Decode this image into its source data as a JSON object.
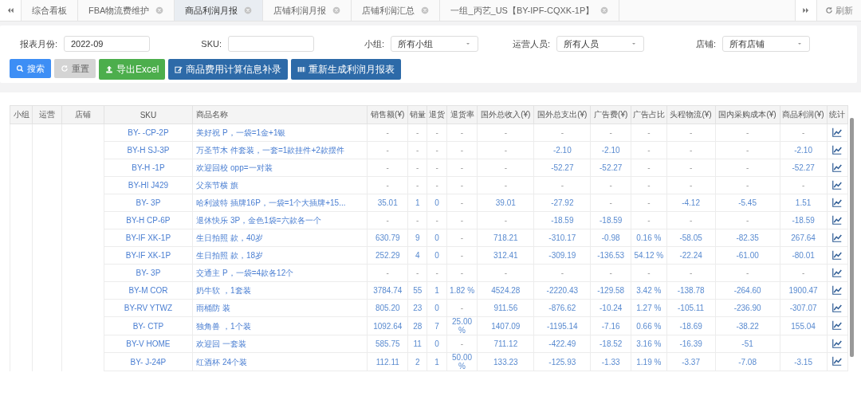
{
  "tabs": [
    {
      "label": "综合看板",
      "selected": false,
      "closable": false
    },
    {
      "label": "FBA物流费维护",
      "selected": false,
      "closable": true
    },
    {
      "label": "商品利润月报",
      "selected": true,
      "closable": true
    },
    {
      "label": "店铺利润月报",
      "selected": false,
      "closable": true
    },
    {
      "label": "店铺利润汇总",
      "selected": false,
      "closable": true
    },
    {
      "label": "一组_丙艺_US【BY-IPF-CQXK-1P】",
      "selected": false,
      "closable": true
    }
  ],
  "refresh_label": "刷新",
  "filters": [
    {
      "label": "报表月份:",
      "kind": "text",
      "value": "2022-09"
    },
    {
      "label": "SKU:",
      "kind": "text"
    },
    {
      "label": "小组:",
      "kind": "select",
      "value": "所有小组"
    },
    {
      "label": "运营人员:",
      "kind": "select",
      "value": "所有人员"
    },
    {
      "label": "店铺:",
      "kind": "select",
      "value": "所有店铺"
    }
  ],
  "buttons": [
    {
      "label": "搜索",
      "kind": "search",
      "disabled": false
    },
    {
      "label": "重置",
      "kind": "reset",
      "disabled": true
    },
    {
      "label": "导出Excel",
      "kind": "export",
      "disabled": false
    },
    {
      "label": "商品费用计算信息补录",
      "kind": "edit",
      "disabled": false
    },
    {
      "label": "重新生成利润月报表",
      "kind": "regenerate",
      "disabled": false
    }
  ],
  "table": {
    "columns": [
      "小组",
      "运营",
      "店铺",
      "SKU",
      "商品名称",
      "销售额(¥)",
      "销量",
      "退货",
      "退货率",
      "国外总收入(¥)",
      "国外总支出(¥)",
      "广告费(¥)",
      "广告占比",
      "头程物流(¥)",
      "国内采购成本(¥)",
      "商品利润(¥)",
      "统计"
    ],
    "rows": [
      {
        "cells": [
          "",
          "",
          "",
          "BY- -CP-2P",
          "美好祝 P，一袋=1金+1银",
          "-",
          "-",
          "-",
          "-",
          "-",
          "-",
          "-",
          "-",
          "-",
          "-",
          "-"
        ]
      },
      {
        "cells": [
          "",
          "",
          "",
          "BY-H SJ-3P",
          "万圣节木 件套装，一套=1款挂件+2款摆件",
          "-",
          "-",
          "-",
          "-",
          "-",
          "-2.10",
          "-2.10",
          "-",
          "-",
          "-",
          "-2.10"
        ]
      },
      {
        "cells": [
          "",
          "",
          "",
          "BY-H -1P",
          "欢迎回校 opp=一对装",
          "-",
          "-",
          "-",
          "-",
          "-",
          "-52.27",
          "-52.27",
          "-",
          "-",
          "-",
          "-52.27"
        ]
      },
      {
        "cells": [
          "",
          "",
          "",
          "BY-HI J429",
          "父亲节横 旗",
          "-",
          "-",
          "-",
          "-",
          "-",
          "-",
          "-",
          "-",
          "-",
          "-",
          "-"
        ]
      },
      {
        "cells": [
          "",
          "",
          "",
          "BY- 3P",
          "哈利波特 插牌16P，一袋=1个大插牌+15...",
          "35.01",
          "1",
          "0",
          "-",
          "39.01",
          "-27.92",
          "-",
          "-",
          "-4.12",
          "-5.45",
          "1.51"
        ]
      },
      {
        "cells": [
          "",
          "",
          "",
          "BY-H CP-6P",
          "退休快乐 3P，金色1袋=六款各一个",
          "-",
          "-",
          "-",
          "-",
          "-",
          "-18.59",
          "-18.59",
          "-",
          "-",
          "-",
          "-18.59"
        ]
      },
      {
        "cells": [
          "",
          "",
          "",
          "BY-IF XK-1P",
          "生日拍照 款，40岁",
          "630.79",
          "9",
          "0",
          "-",
          "718.21",
          "-310.17",
          "-0.98",
          "0.16 %",
          "-58.05",
          "-82.35",
          "267.64"
        ]
      },
      {
        "cells": [
          "",
          "",
          "",
          "BY-IF XK-1P",
          "生日拍照 款，18岁",
          "252.29",
          "4",
          "0",
          "-",
          "312.41",
          "-309.19",
          "-136.53",
          "54.12 %",
          "-22.24",
          "-61.00",
          "-80.01"
        ]
      },
      {
        "cells": [
          "",
          "",
          "",
          "BY- 3P",
          "交通主 P，一袋=4款各12个",
          "-",
          "-",
          "-",
          "-",
          "-",
          "-",
          "-",
          "-",
          "-",
          "-",
          "-"
        ]
      },
      {
        "cells": [
          "",
          "",
          "",
          "BY-M COR",
          "奶牛软 ，1套装",
          "3784.74",
          "55",
          "1",
          "1.82 %",
          "4524.28",
          "-2220.43",
          "-129.58",
          "3.42 %",
          "-138.78",
          "-264.60",
          "1900.47"
        ]
      },
      {
        "cells": [
          "",
          "",
          "",
          "BY-RV YTWZ",
          "雨桶防 装",
          "805.20",
          "23",
          "0",
          "-",
          "911.56",
          "-876.62",
          "-10.24",
          "1.27 %",
          "-105.11",
          "-236.90",
          "-307.07"
        ]
      },
      {
        "cells": [
          "",
          "",
          "",
          "BY- CTP",
          "独角兽 ，1个装",
          "1092.64",
          "28",
          "7",
          "25.00 %",
          "1407.09",
          "-1195.14",
          "-7.16",
          "0.66 %",
          "-18.69",
          "-38.22",
          "155.04"
        ]
      },
      {
        "cells": [
          "",
          "",
          "",
          "BY-V HOME",
          "欢迎回 一套装",
          "585.75",
          "11",
          "0",
          "-",
          "711.12",
          "-422.49",
          "-18.52",
          "3.16 %",
          "-16.39",
          "-51",
          ""
        ]
      },
      {
        "cells": [
          "",
          "",
          "",
          "BY- J-24P",
          "红酒杯 24个装",
          "112.11",
          "2",
          "1",
          "50.00 %",
          "133.23",
          "-125.93",
          "-1.33",
          "1.19 %",
          "-3.37",
          "-7.08",
          "-3.15"
        ]
      }
    ]
  }
}
